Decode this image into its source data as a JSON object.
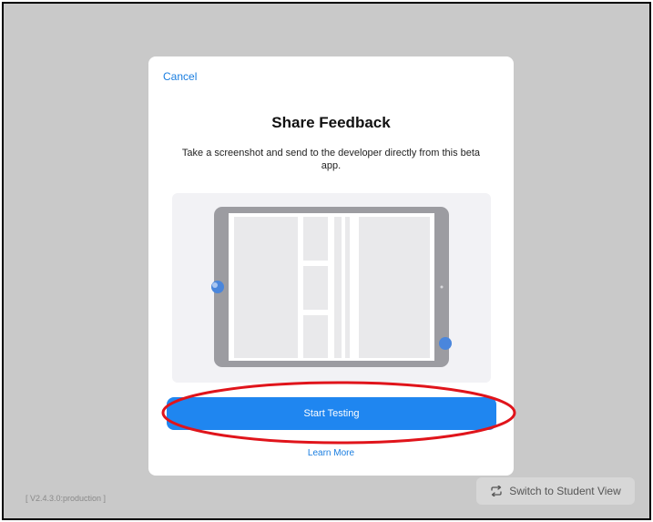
{
  "modal": {
    "cancel_label": "Cancel",
    "title": "Share Feedback",
    "subtitle": "Take a screenshot and send to the developer directly from this beta app.",
    "start_button_label": "Start Testing",
    "learn_more_label": "Learn More"
  },
  "footer": {
    "version": "[ V2.4.3.0:production ]",
    "switch_button_label": "Switch to Student View",
    "switch_icon": "repeat-arrows-icon"
  },
  "colors": {
    "accent": "#1f86f0",
    "link": "#1a7ee0",
    "highlight": "#e0141b",
    "backdrop": "#c9c9c9"
  }
}
